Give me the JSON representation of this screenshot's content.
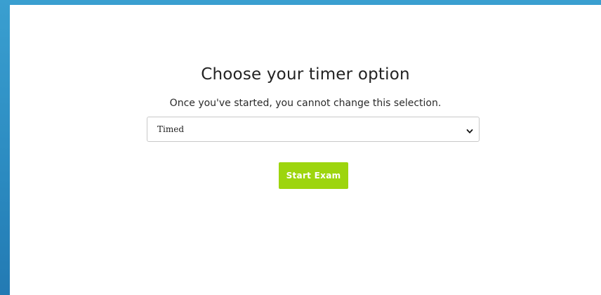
{
  "page": {
    "title": "Choose your timer option",
    "subtitle": "Once you've started, you cannot change this selection."
  },
  "timer_select": {
    "selected": "Timed"
  },
  "actions": {
    "start_label": "Start Exam"
  },
  "colors": {
    "accent": "#9dd50e",
    "background_blue": "#2b8ac0",
    "panel": "#ffffff"
  },
  "icons": {
    "select_indicator": "chevron-down-icon"
  }
}
